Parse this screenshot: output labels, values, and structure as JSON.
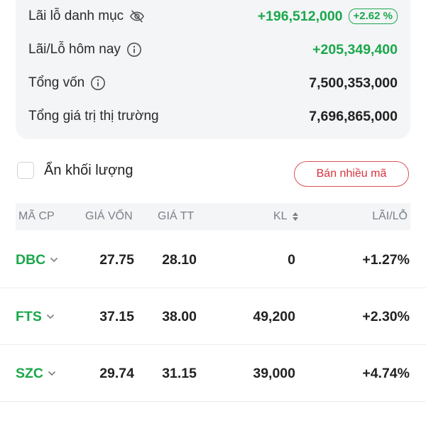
{
  "summary": {
    "rows": [
      {
        "label": "Lãi lỗ danh mục",
        "value": "+196,512,000",
        "badge": "+2.62 %"
      },
      {
        "label": "Lãi/Lỗ hôm nay",
        "value": "+205,349,400"
      },
      {
        "label": "Tổng vốn",
        "value": "7,500,353,000"
      },
      {
        "label": "Tổng giá trị thị trường",
        "value": "7,696,865,000"
      }
    ]
  },
  "controls": {
    "hide_volume_label": "Ẩn khối lượng",
    "hide_volume_checked": false,
    "sell_multiple_label": "Bán nhiều mã"
  },
  "table": {
    "headers": {
      "symbol": "MÃ CP",
      "cost_price": "GIÁ VỐN",
      "market_price": "GIÁ TT",
      "volume": "KL",
      "pnl": "LÃI/LỖ"
    },
    "rows": [
      {
        "symbol": "DBC",
        "cost_price": "27.75",
        "market_price": "28.10",
        "volume": "0",
        "pnl": "+1.27%"
      },
      {
        "symbol": "FTS",
        "cost_price": "37.15",
        "market_price": "38.00",
        "volume": "49,200",
        "pnl": "+2.30%"
      },
      {
        "symbol": "SZC",
        "cost_price": "29.74",
        "market_price": "31.15",
        "volume": "39,000",
        "pnl": "+4.74%"
      }
    ]
  },
  "colors": {
    "positive": "#1aa84a",
    "sell": "#d6333d",
    "card_bg": "#f4f5f7"
  },
  "icons": {
    "eye_off": "eye-off-icon",
    "info": "info-icon",
    "sort": "sort-icon",
    "chevron": "chevron-down-icon"
  }
}
